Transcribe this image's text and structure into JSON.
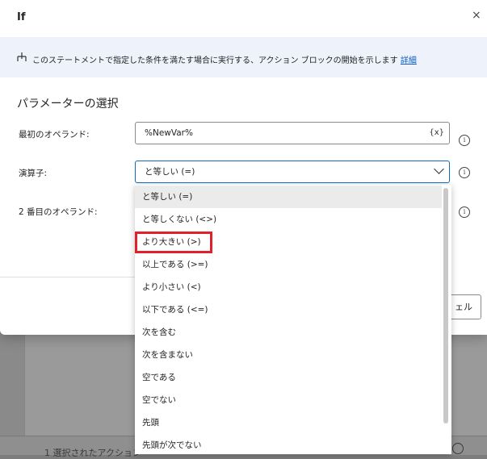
{
  "dialog": {
    "title": "If",
    "close_glyph": "×",
    "info_text": "このステートメントで指定した条件を満たす場合に実行する、アクション ブロックの開始を示します",
    "info_link": "詳細",
    "section_title": "パラメーターの選択"
  },
  "fields": {
    "first_operand_label": "最初のオペランド:",
    "first_operand_value": "%NewVar%",
    "variable_button": "{x}",
    "operator_label": "演算子:",
    "operator_value": "と等しい (=)",
    "second_operand_label": "2 番目のオペランド:",
    "help_glyph": "i"
  },
  "buttons": {
    "cancel_partial": "ェル"
  },
  "dropdown": {
    "options": [
      "と等しい (=)",
      "と等しくない (<>)",
      "より大きい (>)",
      "以上である (>=)",
      "より小さい (<)",
      "以下である (<=)",
      "次を含む",
      "次を含まない",
      "空である",
      "空でない",
      "先頭",
      "先頭が次でない"
    ],
    "selected_index": 0,
    "highlighted_index": 2
  },
  "background": {
    "status_text": "1 選択されたアクション"
  },
  "colors": {
    "accent": "#0f6cbd",
    "link": "#0f5fc2",
    "highlight": "#e0202a",
    "info_bar": "#eef2fb"
  }
}
